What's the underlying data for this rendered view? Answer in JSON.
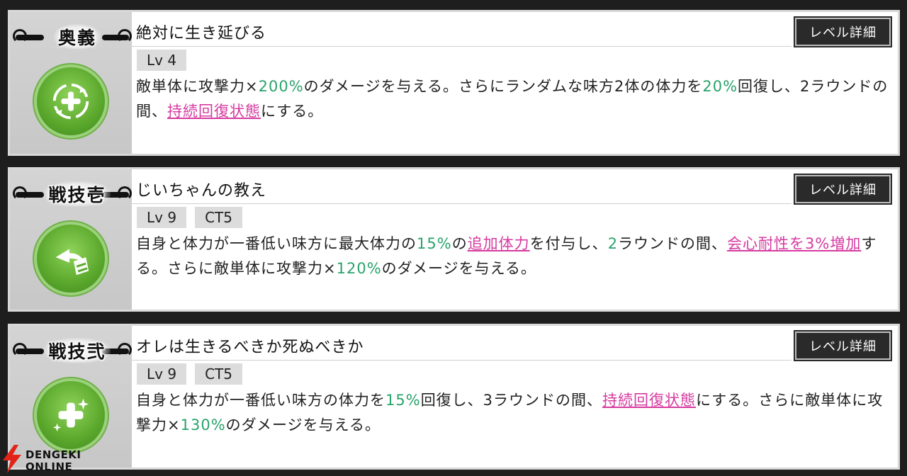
{
  "skills": [
    {
      "tag": "奥義",
      "name": "絶対に生き延びる",
      "detail_label": "レベル詳細",
      "badges": [
        "Lv 4"
      ],
      "icon": "heal-cycle-icon",
      "desc": [
        {
          "t": "敵単体に攻撃力×",
          "k": "n"
        },
        {
          "t": "200%",
          "k": "g"
        },
        {
          "t": "のダメージを与える。さらにランダムな味方2体の体力を",
          "k": "n"
        },
        {
          "t": "20%",
          "k": "g"
        },
        {
          "t": "回復し、2ラウンドの間、",
          "k": "n"
        },
        {
          "t": "持続回復状態",
          "k": "l"
        },
        {
          "t": "にする。",
          "k": "n"
        }
      ]
    },
    {
      "tag": "戦技壱",
      "name": "じいちゃんの教え",
      "detail_label": "レベル詳細",
      "badges": [
        "Lv 9",
        "CT5"
      ],
      "icon": "shield-arrow-icon",
      "desc": [
        {
          "t": "自身と体力が一番低い味方に最大体力の",
          "k": "n"
        },
        {
          "t": "15%",
          "k": "g"
        },
        {
          "t": "の",
          "k": "n"
        },
        {
          "t": "追加体力",
          "k": "l"
        },
        {
          "t": "を付与し、",
          "k": "n"
        },
        {
          "t": "2",
          "k": "g"
        },
        {
          "t": "ラウンドの間、",
          "k": "n"
        },
        {
          "t": "会心耐性を3%増加",
          "k": "l"
        },
        {
          "t": "する。さらに敵単体に攻撃力×",
          "k": "n"
        },
        {
          "t": "120%",
          "k": "g"
        },
        {
          "t": "のダメージを与える。",
          "k": "n"
        }
      ]
    },
    {
      "tag": "戦技弐",
      "name": "オレは生きるべきか死ぬべきか",
      "detail_label": "レベル詳細",
      "badges": [
        "Lv 9",
        "CT5"
      ],
      "icon": "heal-sparkle-icon",
      "desc": [
        {
          "t": "自身と体力が一番低い味方の体力を",
          "k": "n"
        },
        {
          "t": "15%",
          "k": "g"
        },
        {
          "t": "回復し、3ラウンドの間、",
          "k": "n"
        },
        {
          "t": "持続回復状態",
          "k": "l"
        },
        {
          "t": "にする。さらに敵単体に攻撃力×",
          "k": "n"
        },
        {
          "t": "130%",
          "k": "g"
        },
        {
          "t": "のダメージを与える。",
          "k": "n"
        }
      ]
    }
  ],
  "watermark": {
    "line1": "DENGEKI",
    "line2": "ONLINE",
    "accent": "#e2231a"
  },
  "colors": {
    "green": "#2aa36b",
    "link": "#d63aa0",
    "icon": "#5aa72c"
  }
}
